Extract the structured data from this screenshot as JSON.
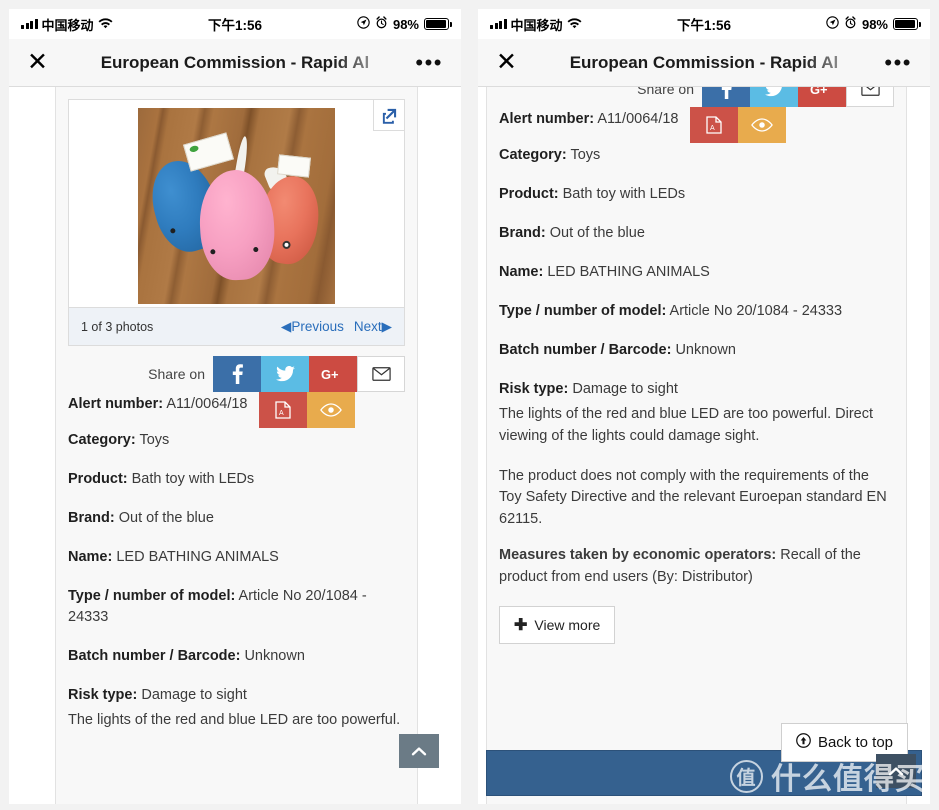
{
  "status_bar": {
    "carrier": "中国移动",
    "time": "下午1:56",
    "battery_percent": "98%",
    "signal_icon": "signal-bars-icon",
    "wifi_icon": "wifi-icon",
    "location_icon": "location-arrow-icon",
    "alarm_icon": "alarm-clock-icon",
    "battery_icon": "battery-icon"
  },
  "nav": {
    "close_label": "✕",
    "title": "European Commission - Rapid Al",
    "more_label": "•••"
  },
  "photo_viewer": {
    "counter": "1 of 3 photos",
    "previous": "Previous",
    "next": "Next",
    "expand_icon": "expand-external-link-icon",
    "prev_arrow": "◀",
    "next_arrow": "▶"
  },
  "share": {
    "label": "Share on",
    "facebook": "f",
    "twitter": "twitter-bird",
    "googleplus": "G+",
    "email": "envelope",
    "pdf": "pdf-file",
    "eye": "eye"
  },
  "record": {
    "alert_number_label": "Alert number:",
    "alert_number_value": "A11/0064/18",
    "category_label": "Category:",
    "category_value": "Toys",
    "product_label": "Product:",
    "product_value": "Bath toy with LEDs",
    "brand_label": "Brand:",
    "brand_value": "Out of the blue",
    "name_label": "Name:",
    "name_value": "LED BATHING ANIMALS",
    "type_label": "Type / number of model:",
    "type_value": "Article No 20/1084 - 24333",
    "batch_label": "Batch number / Barcode:",
    "batch_value": "Unknown",
    "risk_label": "Risk type:",
    "risk_value": "Damage to sight",
    "risk_desc_1": "The lights of the red and blue LED are too powerful. Direct viewing of the lights could damage sight.",
    "risk_desc_1_line1": "The lights of the red and blue LED are too powerful.",
    "risk_desc_2": "The product does not comply with the requirements of the Toy Safety Directive and the relevant Euroepan standard EN 62115.",
    "measures_label": "Measures taken by economic operators:",
    "measures_value": "Recall of the product from end users (By: Distributor)"
  },
  "buttons": {
    "view_more": "View more",
    "view_more_icon": "plus-icon",
    "back_to_top": "Back to top",
    "back_to_top_icon": "circle-up-arrow-icon",
    "scroll_top_icon": "chevron-up-icon"
  },
  "watermark": {
    "badge": "值",
    "text": "什么值得买"
  },
  "colors": {
    "facebook": "#3b6fa8",
    "twitter": "#5bbce4",
    "googleplus": "#cc4b42",
    "pdf": "#cc5248",
    "eye": "#e8ab4d",
    "link": "#2a6ebb",
    "footer": "#35618f"
  }
}
